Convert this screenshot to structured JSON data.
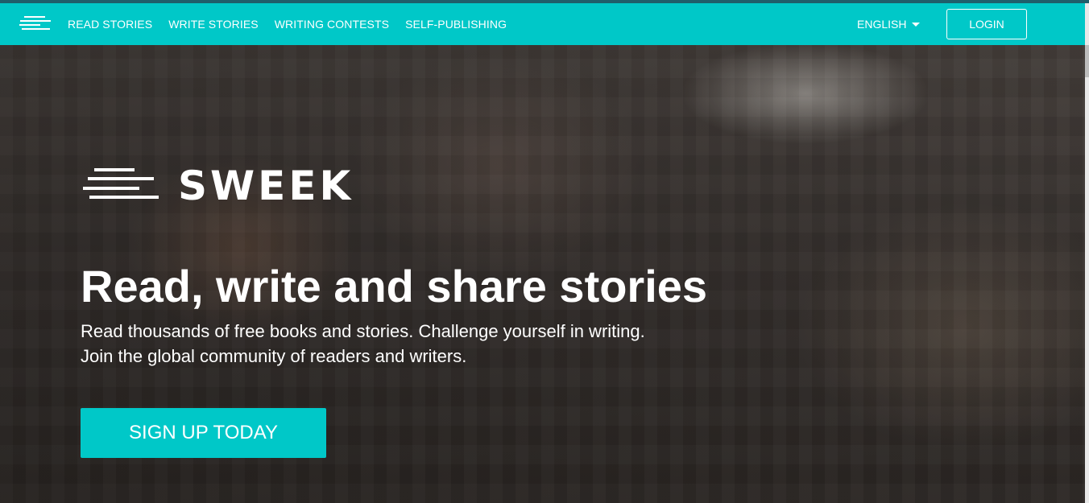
{
  "nav": {
    "links": [
      "READ STORIES",
      "WRITE STORIES",
      "WRITING CONTESTS",
      "SELF-PUBLISHING"
    ],
    "language": "ENGLISH",
    "login": "LOGIN"
  },
  "hero": {
    "brand": "SWEEK",
    "title": "Read, write and share stories",
    "subtitle_line1": "Read thousands of free books and stories. Challenge yourself in writing.",
    "subtitle_line2": "Join the global community of readers and writers.",
    "cta": "SIGN UP TODAY"
  },
  "colors": {
    "accent": "#00c8c8",
    "text": "#ffffff"
  },
  "icons": {
    "logo": "sweek-lines-icon",
    "dropdown": "caret-down-icon"
  }
}
